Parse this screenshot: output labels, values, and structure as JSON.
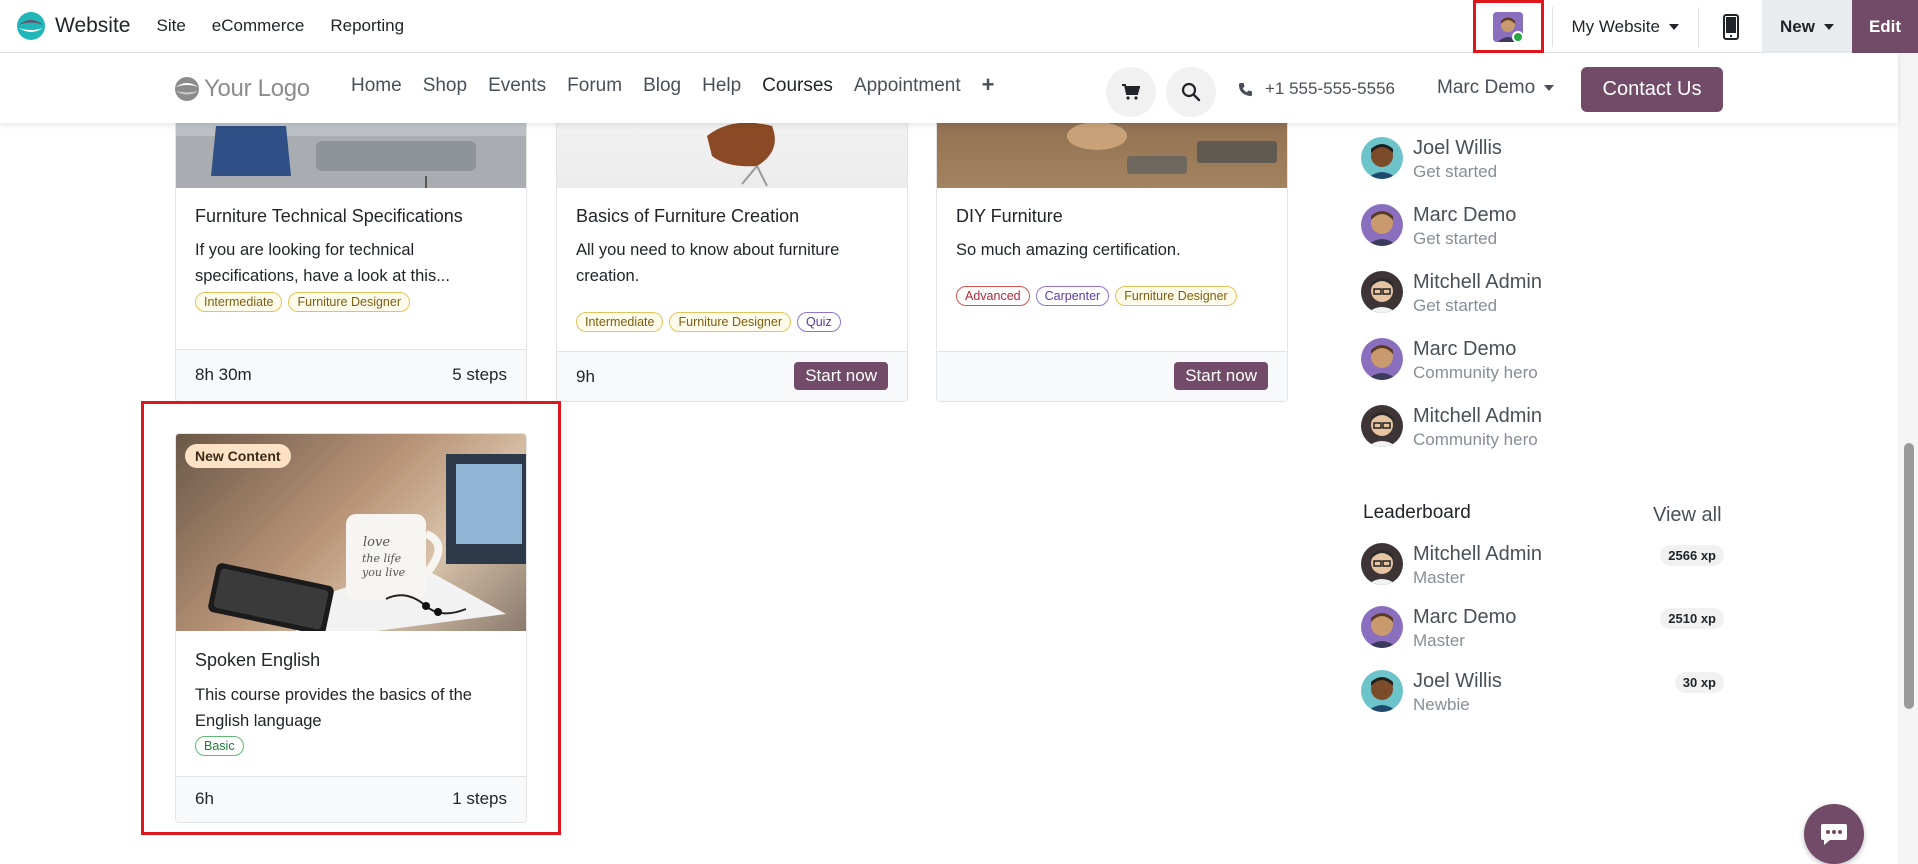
{
  "adminbar": {
    "app_name": "Website",
    "menu": [
      "Site",
      "eCommerce",
      "Reporting"
    ],
    "my_website": "My Website",
    "new_label": "New",
    "edit_label": "Edit"
  },
  "header": {
    "logo_text": "Your Logo",
    "nav": [
      "Home",
      "Shop",
      "Events",
      "Forum",
      "Blog",
      "Help",
      "Courses",
      "Appointment"
    ],
    "active_nav": "Courses",
    "phone": "+1 555-555-5556",
    "user": "Marc Demo",
    "contact_label": "Contact Us"
  },
  "courses": [
    {
      "title": "Furniture Technical Specifications",
      "description": "If you are looking for technical specifications, have a look at this...",
      "tags": [
        {
          "label": "Intermediate",
          "color": "yellow"
        },
        {
          "label": "Furniture Designer",
          "color": "yellow"
        }
      ],
      "duration": "8h 30m",
      "steps": "5 steps"
    },
    {
      "title": "Basics of Furniture Creation",
      "description": "All you need to know about furniture creation.",
      "tags": [
        {
          "label": "Intermediate",
          "color": "yellow"
        },
        {
          "label": "Furniture Designer",
          "color": "yellow"
        },
        {
          "label": "Quiz",
          "color": "purple"
        }
      ],
      "duration": "9h",
      "action": "Start now"
    },
    {
      "title": "DIY Furniture",
      "description": "So much amazing certification.",
      "tags": [
        {
          "label": "Advanced",
          "color": "red"
        },
        {
          "label": "Carpenter",
          "color": "purple"
        },
        {
          "label": "Furniture Designer",
          "color": "yellow"
        }
      ],
      "duration": "",
      "action": "Start now"
    },
    {
      "badge": "New Content",
      "title": "Spoken English",
      "description": "This course provides the basics of the English language",
      "tags": [
        {
          "label": "Basic",
          "color": "green"
        }
      ],
      "duration": "6h",
      "steps": "1 steps"
    }
  ],
  "activity": [
    {
      "name": "Joel Willis",
      "status": "Get started",
      "avatar": "teal"
    },
    {
      "name": "Marc Demo",
      "status": "Get started",
      "avatar": "purple"
    },
    {
      "name": "Mitchell Admin",
      "status": "Get started",
      "avatar": "dark"
    },
    {
      "name": "Marc Demo",
      "status": "Community hero",
      "avatar": "purple"
    },
    {
      "name": "Mitchell Admin",
      "status": "Community hero",
      "avatar": "dark"
    }
  ],
  "leaderboard": {
    "title": "Leaderboard",
    "view_all": "View all",
    "entries": [
      {
        "name": "Mitchell Admin",
        "rank": "Master",
        "xp": "2566 xp",
        "avatar": "dark"
      },
      {
        "name": "Marc Demo",
        "rank": "Master",
        "xp": "2510 xp",
        "avatar": "purple"
      },
      {
        "name": "Joel Willis",
        "rank": "Newbie",
        "xp": "30 xp",
        "avatar": "teal"
      }
    ]
  },
  "colors": {
    "brand": "#714b67",
    "highlight": "#e0161d"
  }
}
